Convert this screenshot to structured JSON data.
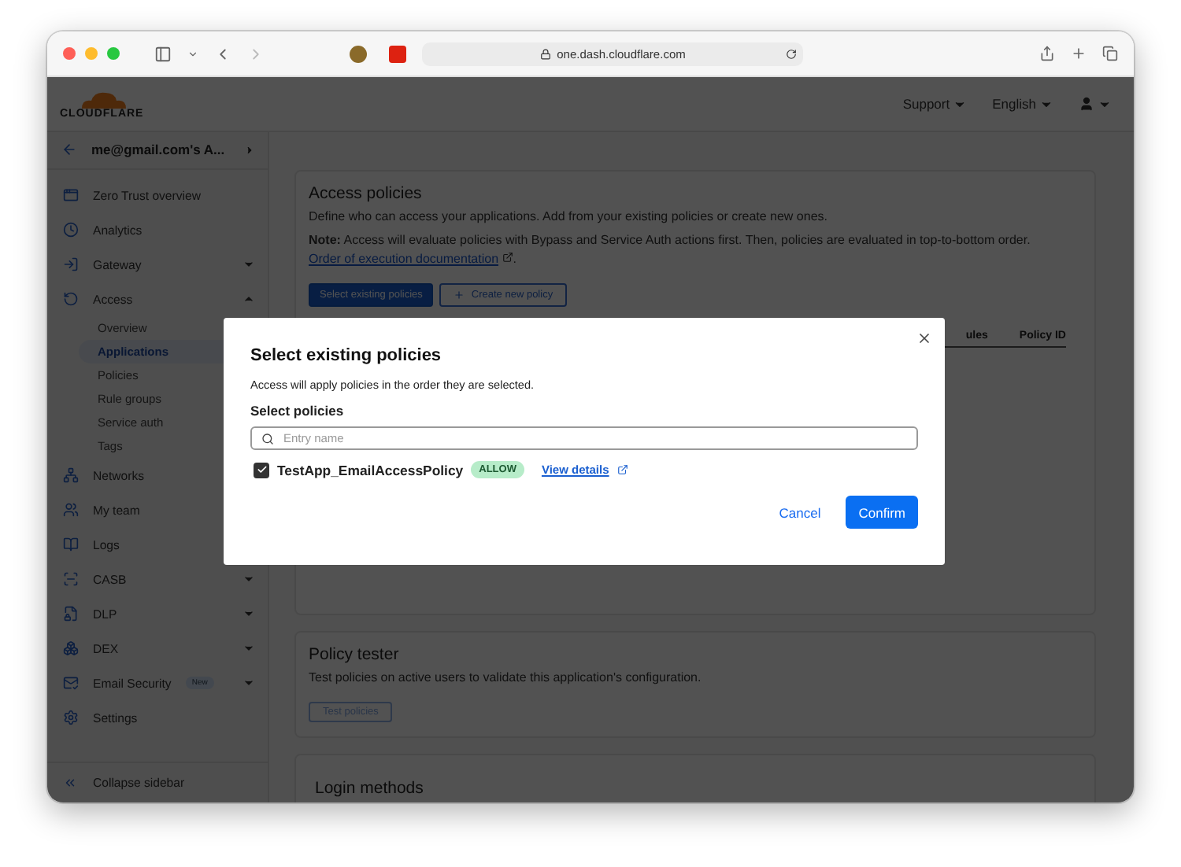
{
  "browser": {
    "url": "one.dash.cloudflare.com"
  },
  "header": {
    "logo": "CLOUDFLARE",
    "menus": [
      "Support",
      "English"
    ]
  },
  "sidebar": {
    "account": "me@gmail.com's A...",
    "items": [
      {
        "label": "Zero Trust overview"
      },
      {
        "label": "Analytics"
      },
      {
        "label": "Gateway",
        "expanded": false
      },
      {
        "label": "Access",
        "expanded": true,
        "children": [
          {
            "label": "Overview",
            "selected": false
          },
          {
            "label": "Applications",
            "selected": true
          },
          {
            "label": "Policies",
            "selected": false
          },
          {
            "label": "Rule groups",
            "selected": false
          },
          {
            "label": "Service auth",
            "selected": false
          },
          {
            "label": "Tags",
            "selected": false
          }
        ]
      },
      {
        "label": "Networks"
      },
      {
        "label": "My team"
      },
      {
        "label": "Logs"
      },
      {
        "label": "CASB",
        "expanded": false
      },
      {
        "label": "DLP",
        "expanded": false
      },
      {
        "label": "DEX",
        "expanded": false
      },
      {
        "label": "Email Security",
        "badge": "New",
        "expanded": false
      },
      {
        "label": "Settings"
      }
    ],
    "collapse": "Collapse sidebar"
  },
  "access_policies": {
    "title": "Access policies",
    "description": "Define who can access your applications. Add from your existing policies or create new ones.",
    "note": "**Note:** Access will evaluate policies with Bypass and Service Auth actions first. Then, policies are evaluated in top-to-bottom order.",
    "link": "Order of execution documentation",
    "note_end": ".",
    "primary_button": "Select existing policies",
    "secondary_button": "Create new policy",
    "columns": [
      "ules",
      "Policy ID"
    ]
  },
  "policy_tester": {
    "title": "Policy tester",
    "description": "Test policies on active users to validate this application's configuration.",
    "button": "Test policies"
  },
  "login_methods": {
    "title": "Login methods"
  },
  "modal": {
    "title": "Select existing policies",
    "description": "Access will apply policies in the order they are selected.",
    "select_label": "Select policies",
    "search_placeholder": "Entry name",
    "policies": [
      {
        "name": "TestApp_EmailAccessPolicy",
        "checked": true,
        "action": "ALLOW",
        "link": "View details"
      }
    ],
    "cancel": "Cancel",
    "confirm": "Confirm"
  }
}
